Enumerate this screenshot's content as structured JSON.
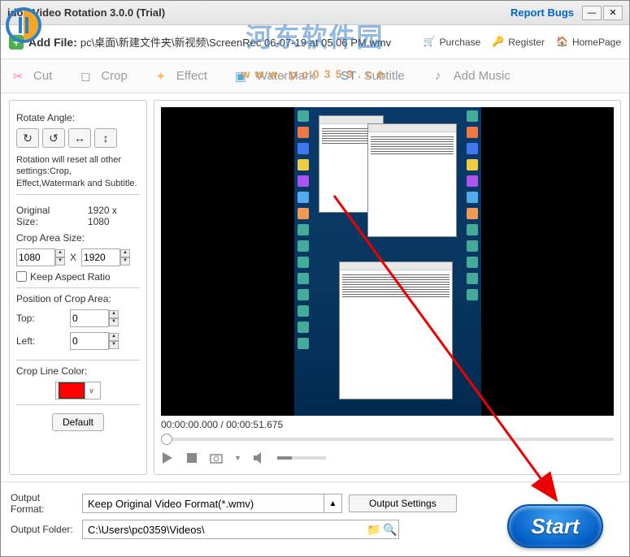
{
  "titlebar": {
    "title": "idoo Video Rotation 3.0.0 (Trial)",
    "report": "Report Bugs"
  },
  "watermark": {
    "main": "河东软件园",
    "sub": "www.pc0359.cn"
  },
  "topbar": {
    "addfile": "Add File:",
    "path": "pc\\桌面\\新建文件夹\\新视频\\ScreenRec 06-07-19 at 05.06 PM.wmv",
    "purchase": "Purchase",
    "register": "Register",
    "homepage": "HomePage"
  },
  "toolbar": {
    "cut": "Cut",
    "crop": "Crop",
    "effect": "Effect",
    "watermark": "WaterMark",
    "subtitle": "Subtitle",
    "addmusic": "Add Music"
  },
  "side": {
    "rotate_label": "Rotate Angle:",
    "note": "Rotation will reset all other settings:Crop, Effect,Watermark and Subtitle.",
    "orig_label": "Original Size:",
    "orig_value": "1920 x 1080",
    "crop_label": "Crop Area Size:",
    "width": "1080",
    "x": "X",
    "height": "1920",
    "keepratio": "Keep Aspect Ratio",
    "pos_label": "Position of Crop Area:",
    "top": "Top:",
    "left": "Left:",
    "top_v": "0",
    "left_v": "0",
    "color_label": "Crop Line Color:",
    "default": "Default"
  },
  "player": {
    "time": "00:00:00.000 / 00:00:51.675"
  },
  "bottom": {
    "fmt_label": "Output Format:",
    "fmt_value": "Keep Original Video Format(*.wmv)",
    "settings": "Output Settings",
    "folder_label": "Output Folder:",
    "folder_value": "C:\\Users\\pc0359\\Videos\\"
  },
  "start": "Start"
}
